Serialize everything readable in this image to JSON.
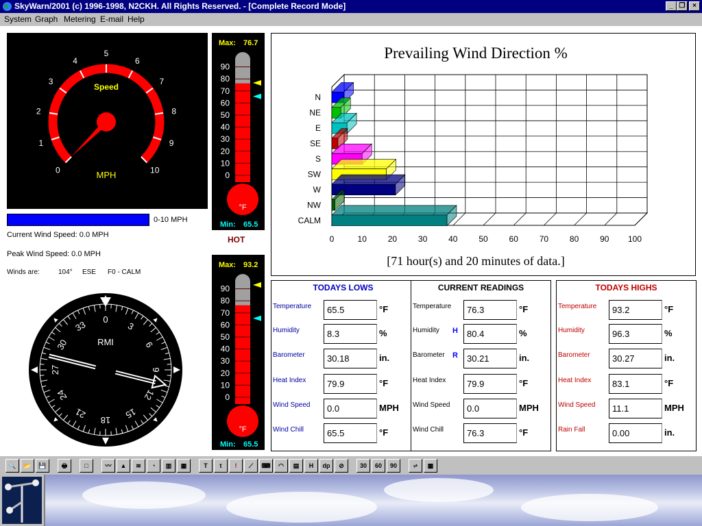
{
  "window": {
    "title": "SkyWarn/2001 (c) 1996-1998, N2CKH. All Rights Reserved. - [Complete Record Mode]",
    "controls": [
      "_",
      "❐",
      "×"
    ]
  },
  "menu": [
    "System",
    "Graph",
    "Metering",
    "E-mail",
    "Help"
  ],
  "speedometer": {
    "label": "Speed",
    "unit": "MPH",
    "ticks": [
      "0",
      "1",
      "2",
      "3",
      "4",
      "5",
      "6",
      "7",
      "8",
      "9",
      "10"
    ],
    "needle_value": 0.0
  },
  "speed_bar": {
    "range_label": "0-10 MPH",
    "fill_fraction": 1.0
  },
  "wind_info": {
    "current": "Current  Wind Speed: 0.0 MPH",
    "peak": "Peak Wind Speed: 0.0 MPH",
    "winds_are": "Winds are:",
    "degrees": "104°",
    "direction": "ESE",
    "force": "F0 - CALM"
  },
  "thermo_top": {
    "max_label": "Max:",
    "max_value": "76.7",
    "min_label": "Min:",
    "min_value": "65.5",
    "unit": "°F",
    "scale": [
      "90",
      "80",
      "70",
      "60",
      "50",
      "40",
      "30",
      "20",
      "10",
      "0"
    ],
    "level": 76.3,
    "max_marker": 76.7,
    "min_marker": 65.5,
    "status": "HOT"
  },
  "thermo_bottom": {
    "max_label": "Max:",
    "max_value": "93.2",
    "min_label": "Min:",
    "min_value": "65.5",
    "unit": "°F",
    "scale": [
      "90",
      "80",
      "70",
      "60",
      "50",
      "40",
      "30",
      "20",
      "10",
      "0"
    ],
    "level": 76.3,
    "max_marker": 93.2,
    "min_marker": 65.5
  },
  "compass": {
    "label": "RMI",
    "labels": [
      "0",
      "3",
      "6",
      "9",
      "12",
      "15",
      "18",
      "21",
      "24",
      "27",
      "30",
      "33"
    ],
    "heading_deg": 104
  },
  "chart_data": {
    "type": "bar",
    "orientation": "horizontal",
    "title": "Prevailing Wind Direction %",
    "caption": "[71 hour(s) and 20 minutes of data.]",
    "categories": [
      "N",
      "NE",
      "E",
      "SE",
      "S",
      "SW",
      "W",
      "NW",
      "CALM"
    ],
    "values": [
      4,
      3,
      5,
      2,
      10,
      18,
      21,
      1,
      38
    ],
    "colors": [
      "#0000ff",
      "#00c000",
      "#00c0c0",
      "#c00000",
      "#ff00ff",
      "#ffff00",
      "#000080",
      "#006000",
      "#008080"
    ],
    "xticks": [
      "0",
      "10",
      "20",
      "30",
      "40",
      "50",
      "60",
      "70",
      "80",
      "90",
      "100"
    ],
    "xlim": [
      0,
      100
    ],
    "grid": true
  },
  "readings": {
    "lows": {
      "title": "TODAYS LOWS",
      "rows": [
        {
          "label": "Temperature",
          "value": "65.5",
          "unit": "°F"
        },
        {
          "label": "Humidity",
          "value": "8.3",
          "unit": "%"
        },
        {
          "label": "Barometer",
          "value": "30.18",
          "unit": "in."
        },
        {
          "label": "Heat Index",
          "value": "79.9",
          "unit": "°F"
        },
        {
          "label": "Wind Speed",
          "value": "0.0",
          "unit": "MPH"
        },
        {
          "label": "Wind Chill",
          "value": "65.5",
          "unit": "°F"
        }
      ]
    },
    "current": {
      "title": "CURRENT READINGS",
      "rows": [
        {
          "label": "Temperature",
          "value": "76.3",
          "unit": "°F"
        },
        {
          "label": "Humidity",
          "value": "80.4",
          "unit": "%",
          "trend": "H"
        },
        {
          "label": "Barometer",
          "value": "30.21",
          "unit": "in.",
          "trend": "R"
        },
        {
          "label": "Heat Index",
          "value": "79.9",
          "unit": "°F"
        },
        {
          "label": "Wind Speed",
          "value": "0.0",
          "unit": "MPH"
        },
        {
          "label": "Wind Chill",
          "value": "76.3",
          "unit": "°F"
        }
      ]
    },
    "highs": {
      "title": "TODAYS HIGHS",
      "rows": [
        {
          "label": "Temperature",
          "value": "93.2",
          "unit": "°F"
        },
        {
          "label": "Humidity",
          "value": "96.3",
          "unit": "%"
        },
        {
          "label": "Barometer",
          "value": "30.27",
          "unit": "in."
        },
        {
          "label": "Heat Index",
          "value": "83.1",
          "unit": "°F"
        },
        {
          "label": "Wind Speed",
          "value": "11.1",
          "unit": "MPH"
        },
        {
          "label": "Rain Fall",
          "value": "0.00",
          "unit": "in."
        }
      ]
    }
  },
  "toolbar": {
    "groups": [
      [
        "preview-icon",
        "open-folder-icon",
        "save-icon"
      ],
      [
        "print-icon"
      ],
      [
        "blank-page-icon"
      ],
      [
        "line-graph-icon",
        "area-graph-icon",
        "stacked-graph-icon",
        "pie-chart-icon",
        "bar-graph-icon",
        "column-graph-icon"
      ],
      [
        "temperature-meter-icon",
        "thermometer-icon",
        "red-thermometer-icon",
        "chart-meter-icon",
        "keyboard-icon",
        "gauge-icon",
        "thermo-icon",
        "humidity-icon",
        "dew-point-icon",
        "compass-icon"
      ],
      [
        "30",
        "60",
        "90"
      ],
      [
        "strip-chart-icon",
        "grid-table-icon"
      ]
    ],
    "text_buttons": {
      "dp": "dp",
      "h": "H",
      "t30": "30",
      "t60": "60",
      "t90": "90"
    }
  }
}
